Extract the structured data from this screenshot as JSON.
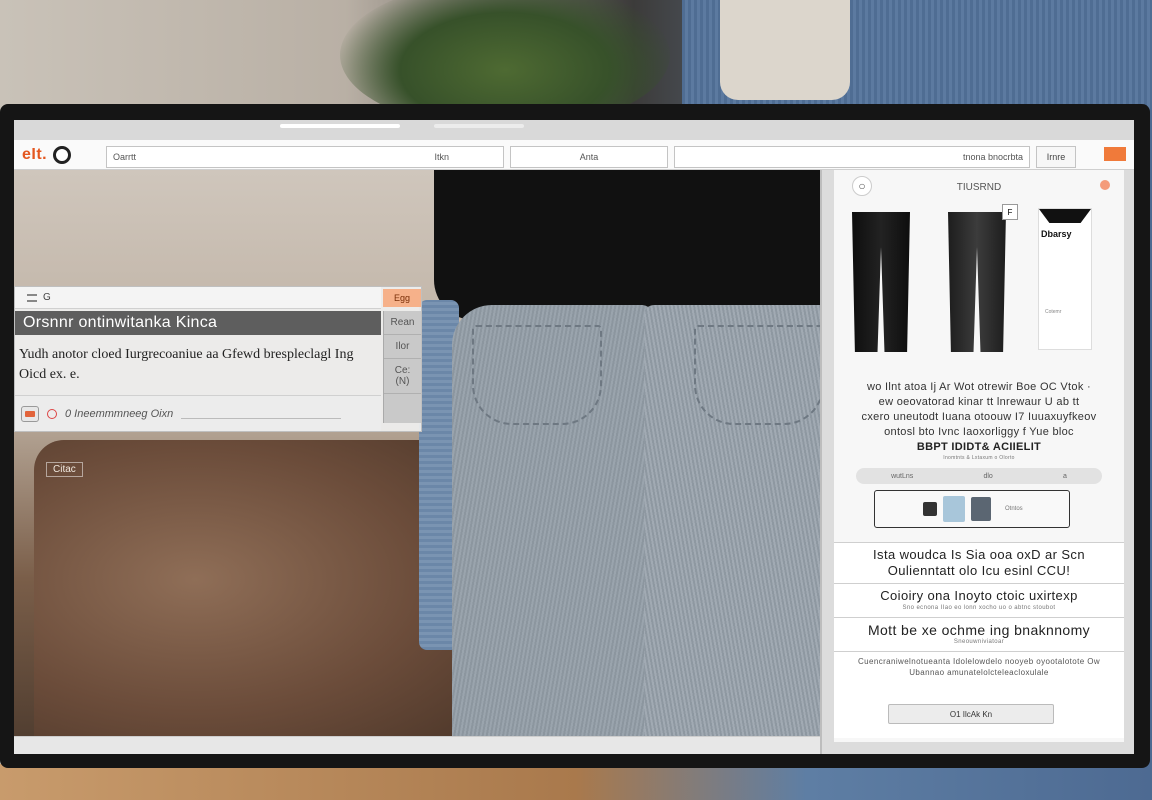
{
  "toolbar": {
    "logo": "eIt.",
    "field1": "Oarrtt",
    "field1_right": "Itkn",
    "field2": "Anta",
    "field3": "tnona bnocrbta",
    "button": "Irnre"
  },
  "photo": {
    "caption": "Citac"
  },
  "dialog": {
    "titlebar_icon": "G",
    "tab": "Egg",
    "header": "Orsnnr ontinwitanka Kinca",
    "body_line1": "Yudh anotor cloed Iurgrecoaniue aa Gfewd brespleclagl Ing",
    "body_line2": "Oicd ex. e.",
    "side_1": "Rean",
    "side_2": "Ilor",
    "side_3": "Ce: (N)",
    "footer_text": "0 Ineemmmneeg Oixn"
  },
  "panel": {
    "title": "TIUSRND",
    "product3_brand": "Dbarsy",
    "product3_small": "Cotemr",
    "desc_line1": "wo Ilnt atoa Ij Ar Wot otrewir Boe OC Vtok ·",
    "desc_line2": "ew oeovatorad kinar tt lnrewaur U ab tt",
    "desc_line3": "cxero uneutodt Iuana otoouw   I7 Iuuaxuyfkeov",
    "desc_line4": "ontosl   bto Ivnc  Iaoxorliggy f Yue bloc",
    "desc_bold": "BBPT   IDIDT& ACIIELIT",
    "desc_sub": "Inomtnts & Lxtaxum o Olorto",
    "slider_labels": [
      "wutLns",
      "dlo",
      "a"
    ],
    "thumb_text": "Otntos",
    "features": [
      {
        "main": "Ista woudca Is Sia ooa oxD ar Scn",
        "main2": "Oulienntatt olo Icu esinl CCU!",
        "sub": ""
      },
      {
        "main": "Coioiry ona Inoyto ctoic uxirtexp",
        "main2": "",
        "sub": "Sno ecnona IIao eo lonn xocho uo o abtnc stoubot"
      },
      {
        "main": "Mott be xe  ochme ing bnaknnomy",
        "main2": "",
        "sub": "Sneouwniviatoar"
      },
      {
        "main": "",
        "main2": "",
        "sub": "Cuencraniwelnotueanta Idolelowdelo nooyeb oyootalotote Ow Ubannao amunatelolcteleacloxulale"
      }
    ],
    "cta": "O1 IlcAk Kn"
  },
  "colors": {
    "accent": "#e4571f",
    "dialog_header": "#5e5e5e",
    "tab_orange": "#f6b18a"
  }
}
